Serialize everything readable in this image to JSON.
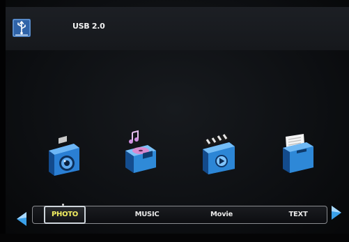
{
  "header": {
    "device_label": "USB 2.0",
    "icon": "usb-icon"
  },
  "tiles": [
    {
      "name": "photo",
      "icon": "camera-icon"
    },
    {
      "name": "music",
      "icon": "music-player-icon"
    },
    {
      "name": "movie",
      "icon": "clapperboard-icon"
    },
    {
      "name": "text",
      "icon": "folder-icon"
    }
  ],
  "menu": {
    "items": [
      {
        "label": "PHOTO",
        "selected": true
      },
      {
        "label": "MUSIC",
        "selected": false
      },
      {
        "label": "Movie",
        "selected": false
      },
      {
        "label": "TEXT",
        "selected": false
      }
    ],
    "selected_color": "#f4f061",
    "accent_color": "#3aa0e8"
  }
}
